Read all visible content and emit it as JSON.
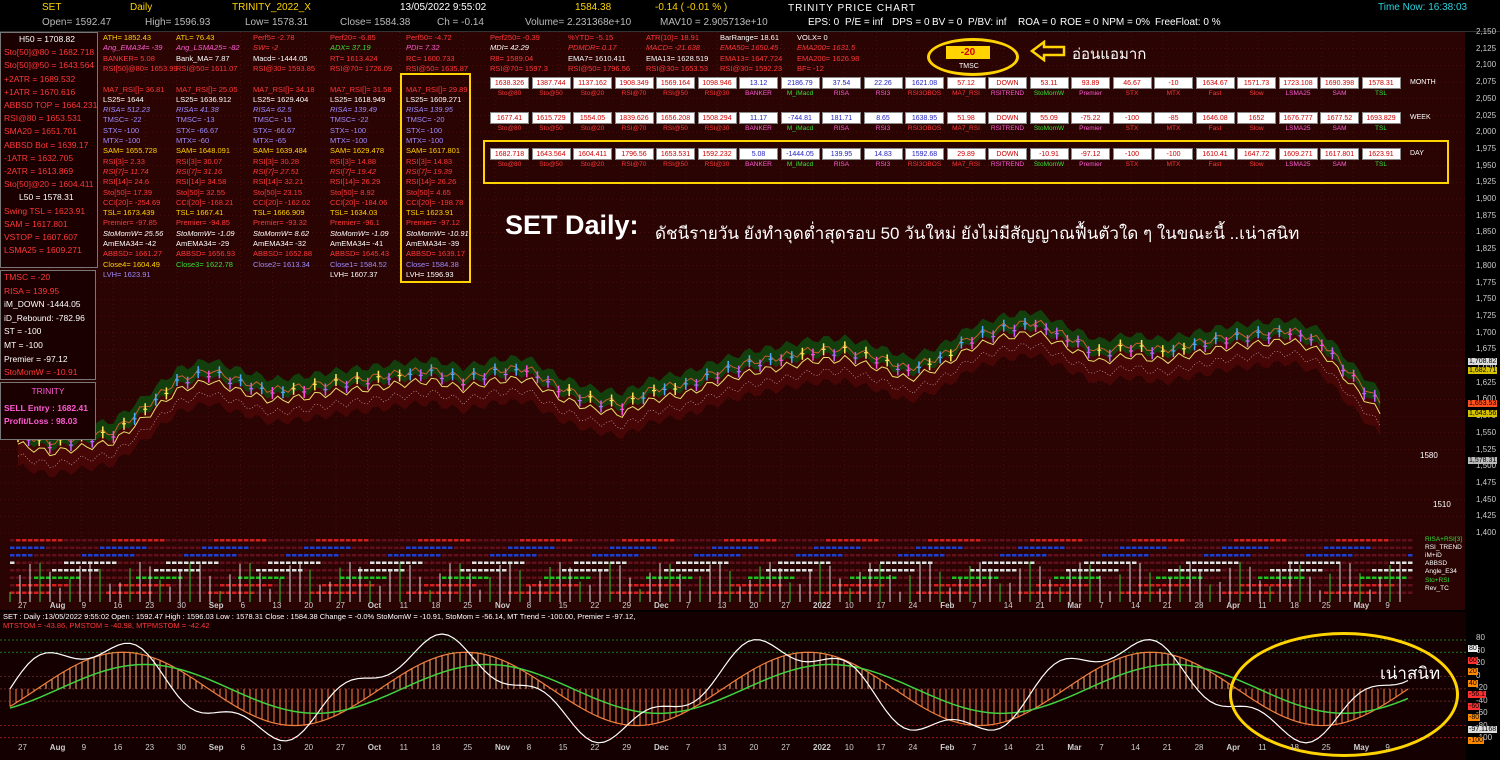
{
  "topbar": {
    "symbol": "SET",
    "period": "Daily",
    "system": "TRINITY_2022_X",
    "datetime": "13/05/2022 9:55:02",
    "last": "1584.38",
    "change": "-0.14 ( -0.01 % )",
    "title": "TRINITY PRICE CHART",
    "time_now": "Time Now: 16:38:03",
    "row2": {
      "open": "Open= 1592.47",
      "high": "High= 1596.93",
      "low": "Low= 1578.31",
      "close": "Close= 1584.38",
      "ch": "Ch = -0.14",
      "volume": "Volume= 2.231368e+10",
      "mav10": "MAV10 = 2.905713e+10",
      "eps": "EPS: 0",
      "pe": "P/E = inf",
      "dps": "DPS = 0",
      "bv": "BV = 0",
      "pbv": "P/BV: inf",
      "roa": "ROA = 0",
      "roe": "ROE = 0",
      "npm": "NPM = 0%",
      "ff": "FreeFloat: 0 %"
    }
  },
  "left_panel": {
    "items": [
      "H50 = 1708.82",
      "Sto[50]@80 = 1682.718",
      "Sto[50]@50 = 1643.564",
      "+2ATR = 1689.532",
      "+1ATR = 1670.616",
      "ABBSD TOP = 1664.231",
      "RSI@80 = 1653.531",
      "SMA20 = 1651.701",
      "ABBSD Bot = 1639.17",
      "-1ATR = 1632.705",
      "-2ATR = 1613.869",
      "Sto[50]@20 = 1604.411",
      "L50 = 1578.31",
      "Swing TSL = 1623.91",
      "SAM = 1617.801",
      "VSTOP = 1607.607",
      "LSMA25 = 1609.271"
    ],
    "items2": [
      "TMSC = -20",
      "RISA = 139.95",
      "iM_DOWN -1444.05",
      "iD_Rebound: -782.96",
      "ST = -100",
      "MT = -100",
      "Premier = -97.12",
      "StoMomW = -10.91"
    ],
    "trinity_title": "TRINITY",
    "sell_entry": "SELL Entry : 1682.41",
    "profit_loss": "Profit/Loss : 98.03"
  },
  "tmsc": {
    "value": "-20",
    "label": "TMSC",
    "note": "อ่อนแอมาก"
  },
  "headline": {
    "main": "SET Daily:",
    "sub": "ดัชนีรายวัน ยังทำจุดต่ำสุดรอบ 50 วันใหม่ ยังไม่มีสัญญาณฟื้นตัวใด ๆ ในขณะนี้ ..เน่าสนิท"
  },
  "bottom_note": "เน่าสนิท",
  "bottom_header": "SET : Daily :13/05/2022 9:55:02 Open : 1592.47 High : 1596.03 Low : 1578.31 Close : 1584.38 Change = -0.0% StoMomW = -10.91, StoMom = -56.14, MT Trend = -100.00, Premier = -97.12,",
  "bottom_header2": "MTSTOM = -43.86, PMSTOM = -40.98, MTPMSTOM = -42.42",
  "table": {
    "labels": [
      "Sto@80",
      "Sto@50",
      "Sto@20",
      "RSI@70",
      "RSI@50",
      "RSI@30",
      "BANKER",
      "M_iMacd",
      "RISA",
      "RSI3",
      "RSI3OBOS",
      "MA7_RSI",
      "RSITREND",
      "StoMomW",
      "Premier",
      "STX",
      "MTX",
      "Fast",
      "Slow",
      "LSMA25",
      "SAM",
      "TSL"
    ],
    "month": [
      "1638.326",
      "1387.744",
      "1137.162",
      "1908.349",
      "1569.164",
      "1098.946",
      "13.12",
      "2186.79",
      "37.54",
      "22.26",
      "1621.08",
      "57.12",
      "DOWN",
      "53.11",
      "93.89",
      "46.67",
      "-10",
      "1634.67",
      "1571.73",
      "1723.108",
      "1690.398",
      "1578.31"
    ],
    "week": [
      "1677.41",
      "1615.729",
      "1554.05",
      "1839.626",
      "1656.208",
      "1508.294",
      "11.17",
      "-744.81",
      "181.71",
      "8.65",
      "1638.95",
      "51.98",
      "DOWN",
      "55.09",
      "-75.22",
      "-100",
      "-85",
      "1646.08",
      "1652",
      "1676.777",
      "1677.52",
      "1693.829"
    ],
    "day": [
      "1682.718",
      "1643.564",
      "1604.411",
      "1796.56",
      "1653.531",
      "1592.232",
      "5.08",
      "-1444.05",
      "139.95",
      "14.83",
      "1592.68",
      "29.89",
      "DOWN",
      "-10.91",
      "-97.12",
      "-100",
      "-100",
      "1610.41",
      "1647.72",
      "1609.271",
      "1617.801",
      "1623.91"
    ],
    "row_names": [
      "MONTH",
      "WEEK",
      "DAY"
    ]
  },
  "columns": [
    [
      "ATH= 1852.43",
      "Ang_EMA34= -39",
      "BANKER= 5.08",
      "RSI[50]@80= 1653.99",
      "",
      "MA7_RSI[]= 36.81",
      "LS25= 1644",
      "RISA= 512.23",
      "TMSC= -22",
      "STX= -100",
      "MTX= -100",
      "SAM= 1655.728",
      "RSI[3]= 2.33",
      "RSI[7]= 11.74",
      "RSI[14]= 24.6",
      "Sto[50]= 17.39",
      "CCI[20]= -254.69",
      "TSL= 1673.439",
      "Premier= -97.85",
      "StoMomW= 25.56",
      "AmEMA34= -42",
      "ABBSD= 1661.27",
      "Close4= 1604.49",
      "LVH= 1623.91"
    ],
    [
      "ATL= 76.43",
      "Ang_LSMA25= -82",
      "Bank_MA= 7.87",
      "RSI@50= 1611.07",
      "",
      "MA7_RSI[]= 25.05",
      "LS25= 1636.912",
      "RISA= 41.38",
      "TMSC= -13",
      "STX= -66.67",
      "MTX= -60",
      "SAM= 1648.091",
      "RSI[3]= 30.07",
      "RSI[7]= 31.16",
      "RSI[14]= 34.58",
      "Sto[50]= 32.55",
      "CCI[20]= -168.21",
      "TSL= 1667.41",
      "Premier= -94.85",
      "StoMomW= -1.09",
      "AmEMA34= -29",
      "ABBSD= 1656.93",
      "Close3= 1622.78",
      ""
    ],
    [
      "Perf5= -2.78",
      "SW= -2",
      "Macd= -1444.05",
      "RSI@30= 1593.85",
      "",
      "MA7_RSI[]= 34.18",
      "LS25= 1629.404",
      "RISA= 62.5",
      "TMSC= -15",
      "STX= -66.67",
      "MTX= -65",
      "SAM= 1639.484",
      "RSI[3]= 30.28",
      "RSI[7]= 27.51",
      "RSI[14]= 32.21",
      "Sto[50]= 23.15",
      "CCI[20]= -162.02",
      "TSL= 1666.909",
      "Premier= -93.32",
      "StoMomW= 8.62",
      "AmEMA34= -32",
      "ABBSD= 1652.88",
      "Close2= 1613.34",
      ""
    ],
    [
      "Perf20= -6.85",
      "ADX= 37.19",
      "RT= 1613.424",
      "RSI@70= 1726.09",
      "",
      "MA7_RSI[]= 31.58",
      "LS25= 1618.949",
      "RISA= 139.49",
      "TMSC= -22",
      "STX= -100",
      "MTX= -100",
      "SAM= 1629.478",
      "RSI[3]= 14.88",
      "RSI[7]= 19.42",
      "RSI[14]= 26.29",
      "Sto[50]= 8.92",
      "CCI[20]= -184.06",
      "TSL= 1634.03",
      "Premier= -96.1",
      "StoMomW= -1.09",
      "AmEMA34= -41",
      "ABBSD= 1645.43",
      "Close1= 1584.52",
      "LVH= 1607.37"
    ],
    [
      "Perf50= -4.72",
      "PDI= 7.32",
      "RC= 1600.733",
      "RSI@50= 1635.87",
      "",
      "MA7_RSI[]= 29.89",
      "LS25= 1609.271",
      "RISA= 139.95",
      "TMSC= -20",
      "STX= -100",
      "MTX= -100",
      "SAM= 1617.801",
      "RSI[3]= 14.83",
      "RSI[7]= 19.39",
      "RSI[14]= 26.26",
      "Sto[50]= 4.65",
      "CCI[20]= -198.78",
      "TSL= 1623.91",
      "Premier= -97.12",
      "StoMomW= -10.91",
      "AmEMA34= -39",
      "ABBSD= 1639.17",
      "Close= 1584.38",
      "LVH= 1596.93"
    ],
    [
      "Perf250= -0.39",
      "MDI= 42.29",
      "R8= 1589.04",
      "RSI@70= 1597.3",
      "",
      "",
      "",
      "",
      "",
      "",
      "",
      "",
      "",
      "",
      "",
      "",
      "",
      "",
      "",
      "",
      "",
      "",
      "",
      ""
    ],
    [
      "%YTD= -5.15",
      "PDMDR= 0.17",
      "EMA7= 1610.411",
      "RSI@50= 1796.56",
      "",
      "",
      "",
      "",
      "",
      "",
      "",
      "",
      "",
      "",
      "",
      "",
      "",
      "",
      "",
      "",
      "",
      "",
      "",
      ""
    ],
    [
      "ATR(10)= 18.91",
      "MACD= -21.638",
      "EMA13= 1628.519",
      "RSI@30= 1653.53",
      "",
      "",
      "",
      "",
      "",
      "",
      "",
      "",
      "",
      "",
      "",
      "",
      "",
      "",
      "",
      "",
      "",
      "",
      "",
      ""
    ],
    [
      "BarRange= 18.61",
      "EMA50= 1650.45",
      "EMA13= 1647.724",
      "RSI@30= 1592.23",
      "",
      "",
      "",
      "",
      "",
      "",
      "",
      "",
      "",
      "",
      "",
      "",
      "",
      "",
      "",
      "",
      "",
      "",
      "",
      ""
    ],
    [
      "VOLX= 0",
      "EMA200= 1631.5",
      "EMA200= 1626.98",
      "BF= -12",
      "",
      "",
      "",
      "",
      "",
      "",
      "",
      "",
      "",
      "",
      "",
      "",
      "",
      "",
      "",
      "",
      "",
      "",
      "",
      ""
    ]
  ],
  "right_axis": {
    "ticks": [
      "2,150",
      "2,125",
      "2,100",
      "2,075",
      "2,050",
      "2,025",
      "2,000",
      "1,975",
      "1,950",
      "1,925",
      "1,900",
      "1,875",
      "1,850",
      "1,825",
      "1,800",
      "1,775",
      "1,750",
      "1,725",
      "1,700",
      "1,675",
      "1,650",
      "1,625",
      "1,600",
      "1,575",
      "1,550",
      "1,525",
      "1,500",
      "1,475",
      "1,450",
      "1,425",
      "1,400"
    ],
    "price_tags": [
      "1,708.82",
      "1,682.71",
      "1,653.53",
      "1,643.56",
      "1,578.31"
    ],
    "level_1580": "1580",
    "level_1510": "1510",
    "osc_ticks": [
      "80",
      "60",
      "20",
      "0",
      "-20",
      "-40",
      "-60",
      "-80",
      "-100"
    ],
    "osc_tags": [
      "80",
      "60",
      "20",
      "40",
      "-56.1",
      "-60",
      "-80",
      "-97.1168",
      "-100"
    ]
  },
  "x_axis": {
    "labels": [
      "27",
      "Aug",
      "9",
      "16",
      "23",
      "30",
      "Sep",
      "6",
      "13",
      "20",
      "27",
      "Oct",
      "11",
      "18",
      "25",
      "Nov",
      "8",
      "15",
      "22",
      "29",
      "Dec",
      "7",
      "13",
      "20",
      "27",
      "2022",
      "10",
      "17",
      "24",
      "Feb",
      "7",
      "14",
      "21",
      "Mar",
      "7",
      "14",
      "21",
      "28",
      "Apr",
      "11",
      "18",
      "25",
      "May",
      "9"
    ]
  },
  "indicator_legend": [
    "RISA+RSI[3]",
    "RSI_TREND",
    "iM+iD",
    "ABBSD",
    "Angle_E34",
    "Sto+RSI",
    "Rev_TC"
  ],
  "chart_data": {
    "type": "line",
    "title": "TRINITY PRICE CHART",
    "ylim": [
      1400,
      2150
    ],
    "x": [
      "27",
      "Aug",
      "9",
      "16",
      "23",
      "30",
      "Sep",
      "6",
      "13",
      "20",
      "27",
      "Oct",
      "11",
      "18",
      "25",
      "Nov",
      "8",
      "15",
      "22",
      "29",
      "Dec",
      "7",
      "13",
      "20",
      "27",
      "2022",
      "10",
      "17",
      "24",
      "Feb",
      "7",
      "14",
      "21",
      "Mar",
      "7",
      "14",
      "21",
      "28",
      "Apr",
      "11",
      "18",
      "25",
      "May",
      "9"
    ],
    "series": [
      {
        "values": [
          1545,
          1532,
          1540,
          1548,
          1585,
          1625,
          1640,
          1624,
          1610,
          1615,
          1623,
          1628,
          1635,
          1640,
          1628,
          1640,
          1643,
          1615,
          1598,
          1590,
          1612,
          1620,
          1638,
          1652,
          1660,
          1670,
          1672,
          1660,
          1642,
          1660,
          1690,
          1705,
          1712,
          1690,
          1668,
          1678,
          1670,
          1680,
          1690,
          1695,
          1700,
          1683,
          1630,
          1584
        ]
      }
    ]
  }
}
